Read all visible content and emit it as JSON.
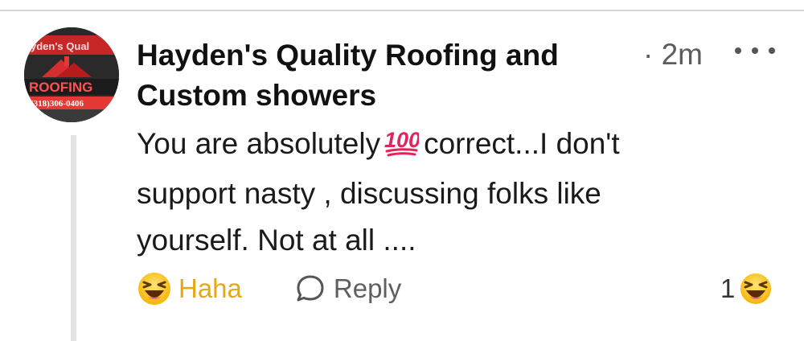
{
  "comment": {
    "author": "Hayden's Quality Roofing and Custom showers",
    "author_line1": "Hayden's Quality Roofing and",
    "author_line2": "Custom showers",
    "timestamp": "2m",
    "timestamp_prefix": "·",
    "body_line1_before": "You are absolutely",
    "body_line1_after": "correct...I don't",
    "body_line2": "support nasty , discussing folks like",
    "body_line3": "yourself. Not at all ....",
    "inline_emoji": "hundred-points-emoji"
  },
  "avatar": {
    "sign_top": "yden's Qual",
    "sign_main": "ROOFING",
    "sign_phone": "(318)306-0406"
  },
  "actions": {
    "reaction_label": "Haha",
    "reaction_icon": "laughing-face-icon",
    "reply_label": "Reply",
    "reply_icon": "speech-bubble-icon"
  },
  "reaction_summary": {
    "count": "1",
    "icon": "laughing-face-icon"
  },
  "colors": {
    "haha": "#e6a817",
    "text": "#1a1a1a",
    "muted": "#5f5f5f",
    "emoji_red": "#e0245e"
  }
}
